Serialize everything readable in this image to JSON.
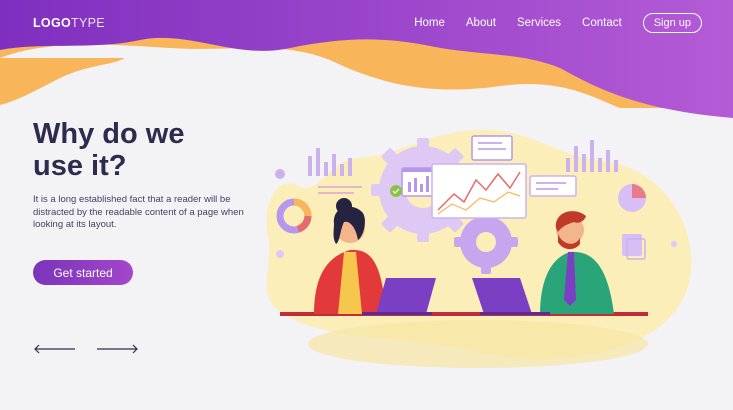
{
  "header": {
    "logo_bold": "LOGO",
    "logo_light": "TYPE",
    "nav": [
      "Home",
      "About",
      "Services",
      "Contact"
    ],
    "signup": "Sign up"
  },
  "hero": {
    "title": "Why do we use it?",
    "description": "It is a long established fact that a reader will be distracted by the readable content of a page when looking at its layout.",
    "cta": "Get started"
  },
  "colors": {
    "purple": "#8a3fc6",
    "purple_light": "#a850d4",
    "orange": "#f9b55a",
    "heading": "#2e2c4e",
    "background": "#f3f2f5"
  },
  "icons": [
    "arrow-left-icon",
    "arrow-right-icon"
  ]
}
